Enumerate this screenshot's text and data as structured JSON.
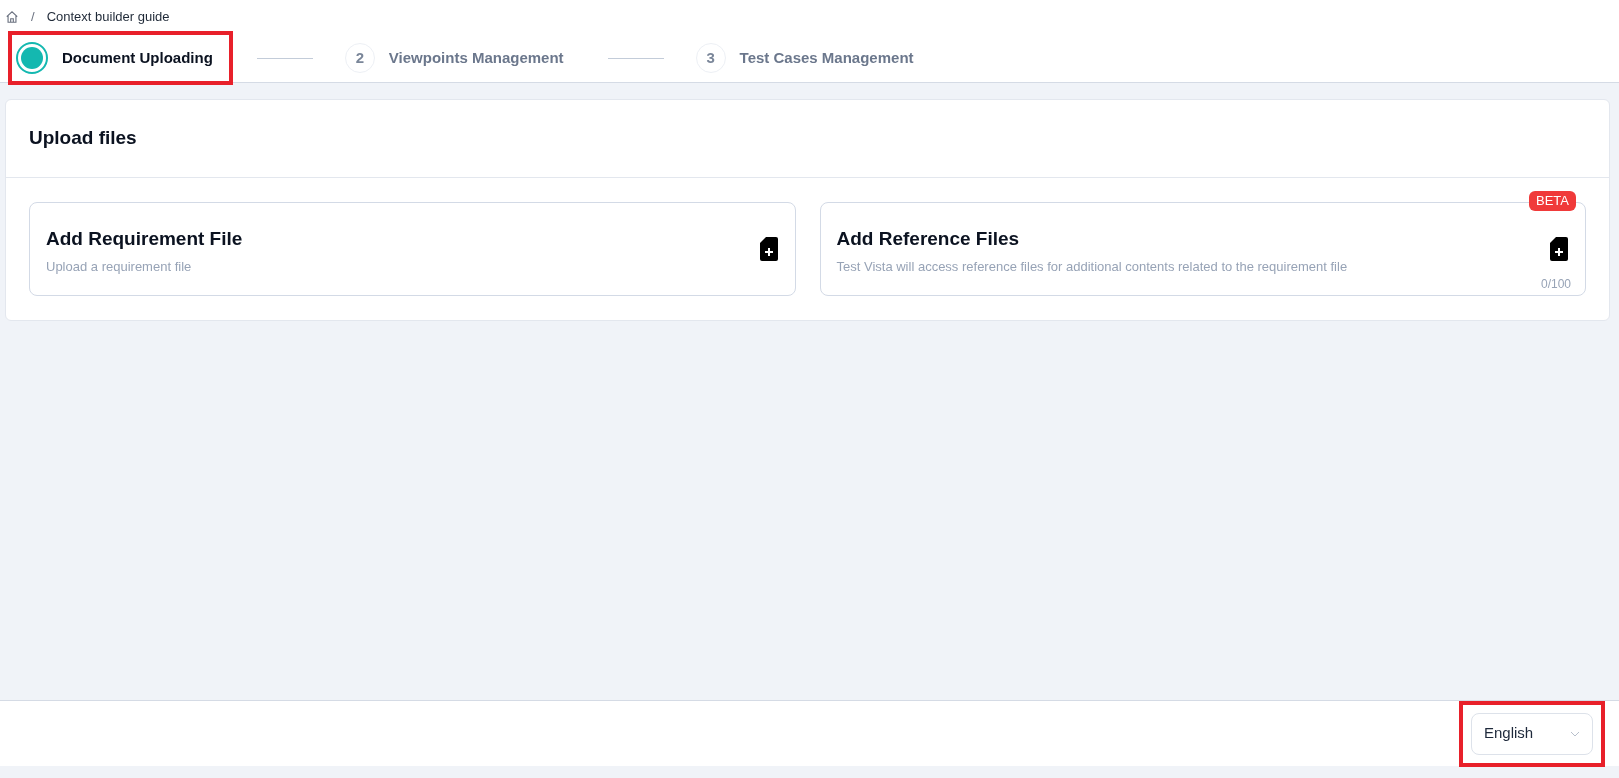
{
  "breadcrumb": {
    "separator": "/",
    "current": "Context builder guide"
  },
  "steps": [
    {
      "label": "Document Uploading",
      "selected": true,
      "highlighted": true
    },
    {
      "number": "2",
      "label": "Viewpoints Management",
      "selected": false,
      "highlighted": false
    },
    {
      "number": "3",
      "label": "Test Cases Management",
      "selected": false,
      "highlighted": false
    }
  ],
  "upload_panel": {
    "title": "Upload files",
    "cards": [
      {
        "title": "Add Requirement File",
        "description": "Upload a requirement file"
      },
      {
        "title": "Add Reference Files",
        "description": "Test Vista will access reference files for additional contents related to the requirement file",
        "badge": "BETA",
        "count": "0/100"
      }
    ]
  },
  "language_selector": {
    "value": "English",
    "highlighted": true
  }
}
